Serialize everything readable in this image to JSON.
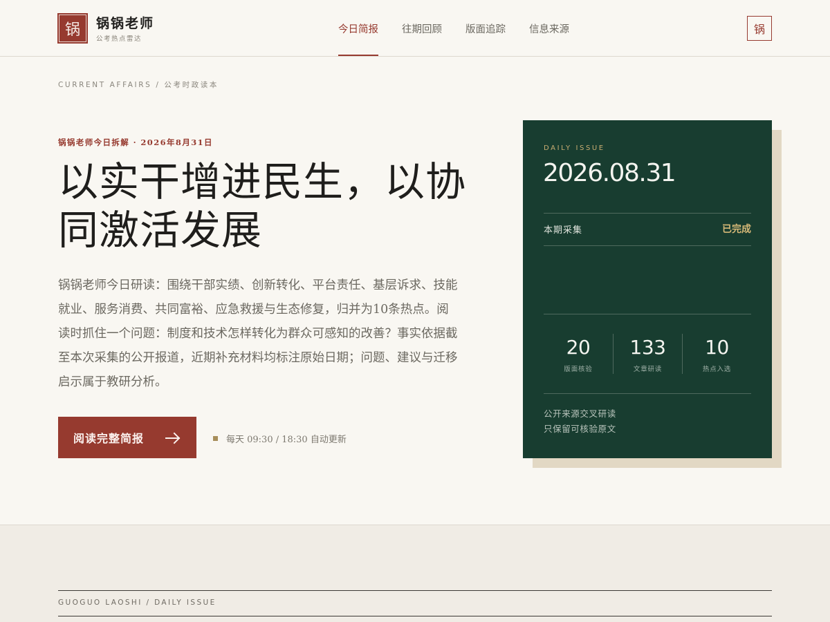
{
  "header": {
    "logo_glyph": "锅",
    "brand_name": "锅锅老师",
    "brand_sub": "公考热点雷达",
    "nav": [
      {
        "label": "今日简报",
        "active": true
      },
      {
        "label": "往期回顾",
        "active": false
      },
      {
        "label": "版面追踪",
        "active": false
      },
      {
        "label": "信息来源",
        "active": false
      }
    ],
    "avatar_glyph": "锅"
  },
  "breadcrumb": "CURRENT AFFAIRS / 公考时政读本",
  "hero": {
    "eyebrow": "锅锅老师今日拆解 · 2026年8月31日",
    "headline": "以实干增进民生，以协同激活发展",
    "intro": "锅锅老师今日研读：围绕干部实绩、创新转化、平台责任、基层诉求、技能就业、服务消费、共同富裕、应急救援与生态修复，归并为10条热点。阅读时抓住一个问题：制度和技术怎样转化为群众可感知的改善？事实依据截至本次采集的公开报道，近期补充材料均标注原始日期；问题、建议与迁移启示属于教研分析。",
    "cta_label": "阅读完整简报",
    "cta_icon": "arrow-right-icon",
    "update_text": "每天 09:30 / 18:30 自动更新"
  },
  "card": {
    "label": "DAILY ISSUE",
    "date": "2026.08.31",
    "status_label": "本期采集",
    "status_value": "已完成",
    "stats": [
      {
        "value": "20",
        "label": "版面核验"
      },
      {
        "value": "133",
        "label": "文章研读"
      },
      {
        "value": "10",
        "label": "热点入选"
      }
    ],
    "note_line1": "公开来源交叉研读",
    "note_line2": "只保留可核验原文"
  },
  "footer": {
    "label": "GUOGUO LAOSHI / DAILY ISSUE"
  },
  "colors": {
    "accent": "#963a2f",
    "card_bg": "#183d30",
    "gold": "#d5b877",
    "page_bg": "#f9f7f2"
  }
}
